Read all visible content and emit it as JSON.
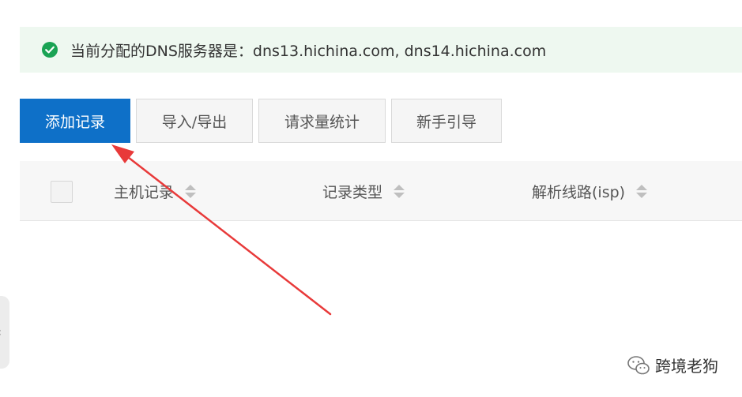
{
  "notice": {
    "icon": "check-circle-icon",
    "text": "当前分配的DNS服务器是：dns13.hichina.com, dns14.hichina.com",
    "color": "#1aa354",
    "background": "#eef8f0"
  },
  "toolbar": {
    "add_record": "添加记录",
    "import_export": "导入/导出",
    "request_stats": "请求量统计",
    "beginner_guide": "新手引导",
    "primary_color": "#0e70c8"
  },
  "table": {
    "columns": [
      "主机记录",
      "记录类型",
      "解析线路(isp)"
    ]
  },
  "annotation": {
    "arrow_color": "#e83a3a"
  },
  "watermark": {
    "icon": "wechat-icon",
    "text": "跨境老狗"
  }
}
